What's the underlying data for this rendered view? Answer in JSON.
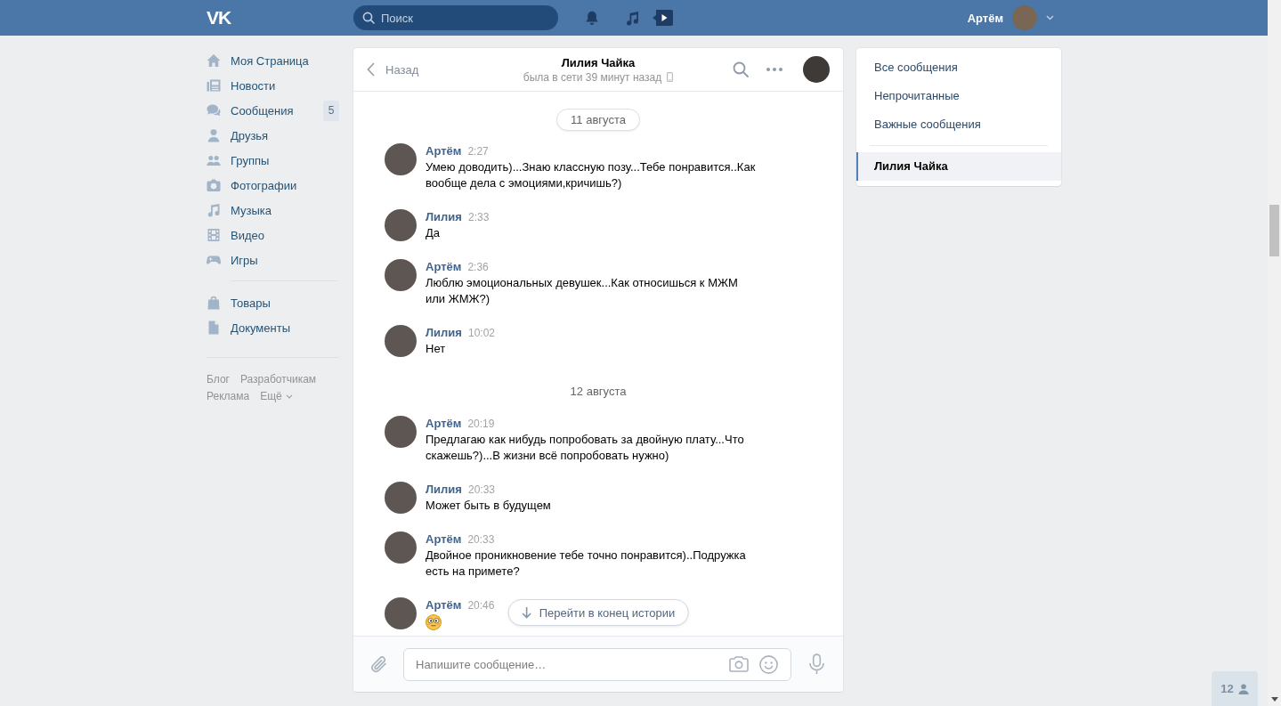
{
  "top_bar": {
    "logo": "VK",
    "search": {
      "placeholder": "Поиск"
    },
    "user": {
      "name": "Артём"
    }
  },
  "sidebar": {
    "groups": [
      {
        "items": [
          {
            "label": "Моя Страница"
          },
          {
            "label": "Новости"
          },
          {
            "label": "Сообщения",
            "count": "5"
          },
          {
            "label": "Друзья"
          },
          {
            "label": "Группы"
          },
          {
            "label": "Фотографии"
          },
          {
            "label": "Музыка"
          },
          {
            "label": "Видео"
          },
          {
            "label": "Игры"
          }
        ]
      },
      {
        "items": [
          {
            "label": "Товары"
          },
          {
            "label": "Документы"
          }
        ]
      }
    ],
    "footer_links": [
      "Блог",
      "Разработчикам",
      "Реклама"
    ],
    "more": "Ещё"
  },
  "dialog": {
    "header": {
      "back": "Назад",
      "title": "Лилия Чайка",
      "status": "была в сети 39 минут назад"
    },
    "timeline": [
      {
        "kind": "date",
        "label": "11 августа",
        "pinned": true
      },
      {
        "kind": "message",
        "author": "Артём",
        "time": "2:27",
        "text": "Умею доводить)...Знаю классную позу...Тебе понравится..Как вообще дела с эмоциями,кричишь?)"
      },
      {
        "kind": "message",
        "author": "Лилия",
        "time": "2:33",
        "text": "Да"
      },
      {
        "kind": "message",
        "author": "Артём",
        "time": "2:36",
        "text": "Люблю эмоциональных девушек...Как относишься к МЖМ или ЖМЖ?)"
      },
      {
        "kind": "message",
        "author": "Лилия",
        "time": "10:02",
        "text": "Нет"
      },
      {
        "kind": "date",
        "label": "12 августа",
        "pinned": false
      },
      {
        "kind": "message",
        "author": "Артём",
        "time": "20:19",
        "text": "Предлагаю как нибудь попробовать за двойную плату...Что скажешь?)...В жизни всё попробовать нужно)"
      },
      {
        "kind": "message",
        "author": "Лилия",
        "time": "20:33",
        "text": "Может быть в будущем"
      },
      {
        "kind": "message",
        "author": "Артём",
        "time": "20:33",
        "text": "Двойное проникновение тебе точно понравится)..Подружка есть на примете?"
      },
      {
        "kind": "emoji",
        "author": "Артём",
        "time": "20:46"
      }
    ],
    "jump_button": {
      "label": "Перейти в конец истории"
    },
    "composer": {
      "placeholder": "Напишите сообщение…"
    }
  },
  "menu": {
    "items": [
      {
        "label": "Все сообщения",
        "selected": false
      },
      {
        "label": "Непрочитанные",
        "selected": false
      },
      {
        "label": "Важные сообщения",
        "selected": false
      }
    ],
    "conversations": [
      {
        "label": "Лилия Чайка",
        "selected": true
      }
    ]
  },
  "online_friends": {
    "count": "12"
  }
}
